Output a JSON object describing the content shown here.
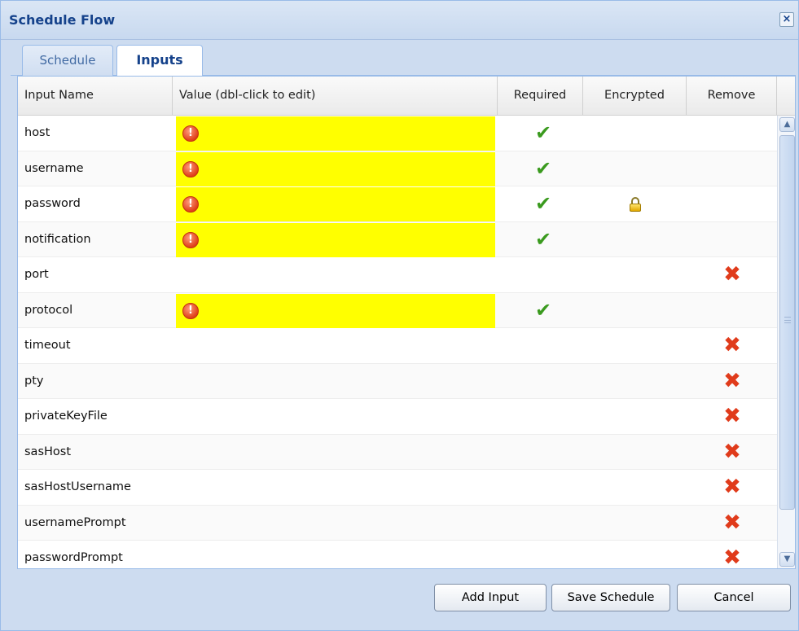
{
  "dialog": {
    "title": "Schedule Flow",
    "close_glyph": "×"
  },
  "tabs": [
    {
      "label": "Schedule",
      "active": false
    },
    {
      "label": "Inputs",
      "active": true
    }
  ],
  "grid": {
    "columns": [
      "Input Name",
      "Value (dbl-click to edit)",
      "Required",
      "Encrypted",
      "Remove"
    ],
    "rows": [
      {
        "name": "host",
        "value": "",
        "missing": true,
        "required": true,
        "encrypted": false,
        "removable": false
      },
      {
        "name": "username",
        "value": "",
        "missing": true,
        "required": true,
        "encrypted": false,
        "removable": false
      },
      {
        "name": "password",
        "value": "",
        "missing": true,
        "required": true,
        "encrypted": true,
        "removable": false
      },
      {
        "name": "notification",
        "value": "",
        "missing": true,
        "required": true,
        "encrypted": false,
        "removable": false
      },
      {
        "name": "port",
        "value": "",
        "missing": false,
        "required": false,
        "encrypted": false,
        "removable": true
      },
      {
        "name": "protocol",
        "value": "",
        "missing": true,
        "required": true,
        "encrypted": false,
        "removable": false
      },
      {
        "name": "timeout",
        "value": "",
        "missing": false,
        "required": false,
        "encrypted": false,
        "removable": true
      },
      {
        "name": "pty",
        "value": "",
        "missing": false,
        "required": false,
        "encrypted": false,
        "removable": true
      },
      {
        "name": "privateKeyFile",
        "value": "",
        "missing": false,
        "required": false,
        "encrypted": false,
        "removable": true
      },
      {
        "name": "sasHost",
        "value": "",
        "missing": false,
        "required": false,
        "encrypted": false,
        "removable": true
      },
      {
        "name": "sasHostUsername",
        "value": "",
        "missing": false,
        "required": false,
        "encrypted": false,
        "removable": true
      },
      {
        "name": "usernamePrompt",
        "value": "",
        "missing": false,
        "required": false,
        "encrypted": false,
        "removable": true
      },
      {
        "name": "passwordPrompt",
        "value": "",
        "missing": false,
        "required": false,
        "encrypted": false,
        "removable": true
      }
    ],
    "icons": {
      "missing": "warning-icon",
      "required": "checkmark-icon",
      "encrypted": "lock-icon",
      "remove": "remove-x-icon"
    },
    "colors": {
      "missing_value_bg": "#ffff00",
      "check": "#3a9a1e",
      "remove": "#e03b1b"
    }
  },
  "buttons": {
    "add_label": "Add Input",
    "save_label": "Save Schedule",
    "cancel_label": "Cancel"
  }
}
